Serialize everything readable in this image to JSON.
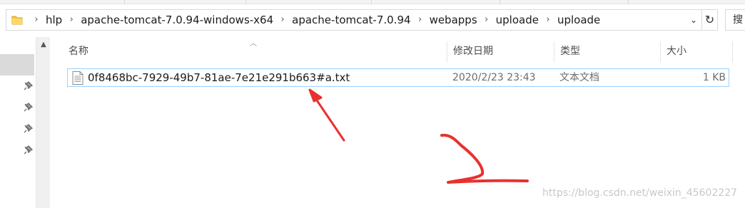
{
  "address_bar": {
    "crumbs": [
      "hlp",
      "apache-tomcat-7.0.94-windows-x64",
      "apache-tomcat-7.0.94",
      "webapps",
      "uploade",
      "uploade"
    ]
  },
  "search": {
    "placeholder": "搜"
  },
  "columns": {
    "name": "名称",
    "date": "修改日期",
    "type": "类型",
    "size": "大小"
  },
  "files": [
    {
      "name": "0f8468bc-7929-49b7-81ae-7e21e291b663#a.txt",
      "date": "2020/2/23 23:43",
      "type": "文本文档",
      "size": "1 KB"
    }
  ],
  "watermark": "https://blog.csdn.net/weixin_45602227",
  "colors": {
    "selection_border": "#99d1ff",
    "annotation_red": "#e8312f",
    "folder_yellow": "#f5c448"
  },
  "icons": [
    "folder-icon",
    "chevron-right-icon",
    "chevron-down-icon",
    "refresh-icon",
    "pin-icon",
    "text-file-icon",
    "scroll-up-icon"
  ]
}
